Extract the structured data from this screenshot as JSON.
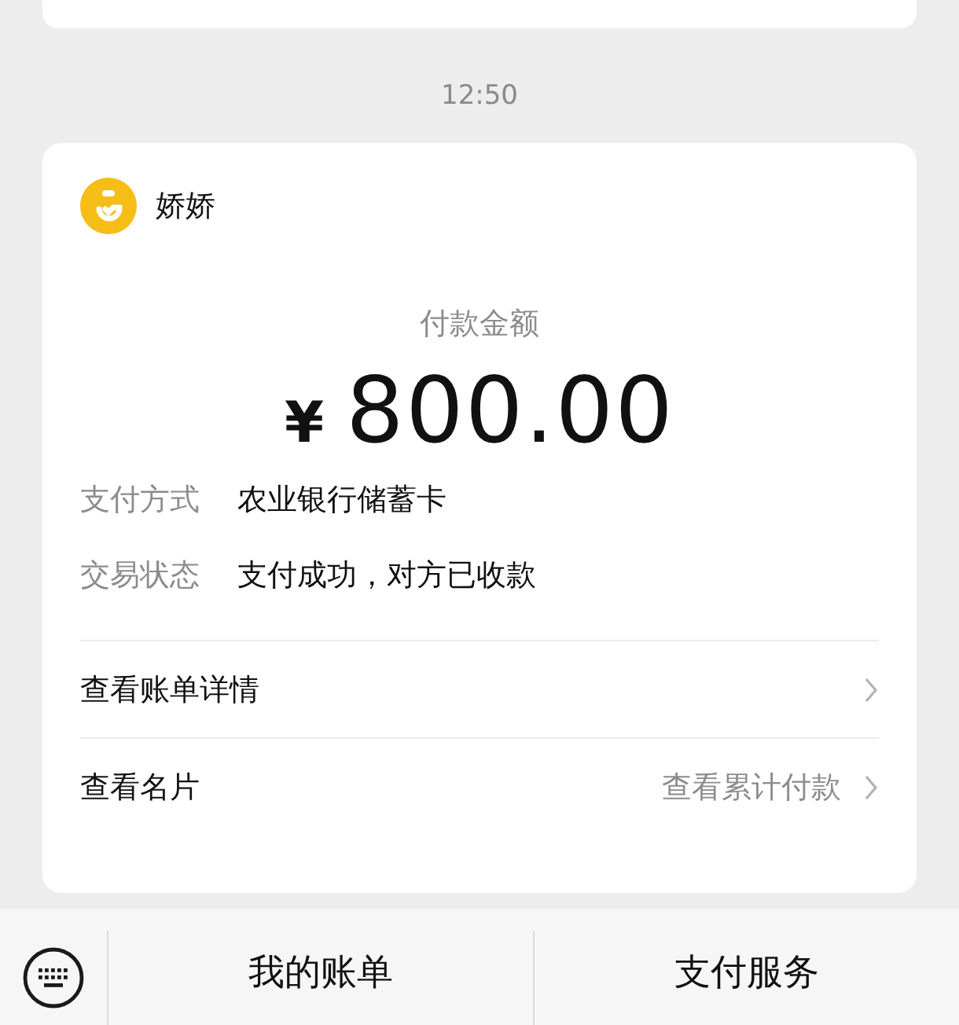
{
  "timestamp": "12:50",
  "card": {
    "payee": "娇娇",
    "amount_label": "付款金额",
    "amount": "800.00",
    "currency": "¥",
    "details": [
      {
        "label": "支付方式",
        "value": "农业银行储蓄卡"
      },
      {
        "label": "交易状态",
        "value": "支付成功，对方已收款"
      }
    ],
    "links": [
      {
        "label": "查看账单详情"
      },
      {
        "label": "查看名片",
        "extra": "查看累计付款"
      }
    ]
  },
  "menu": [
    "我的账单",
    "支付服务"
  ]
}
